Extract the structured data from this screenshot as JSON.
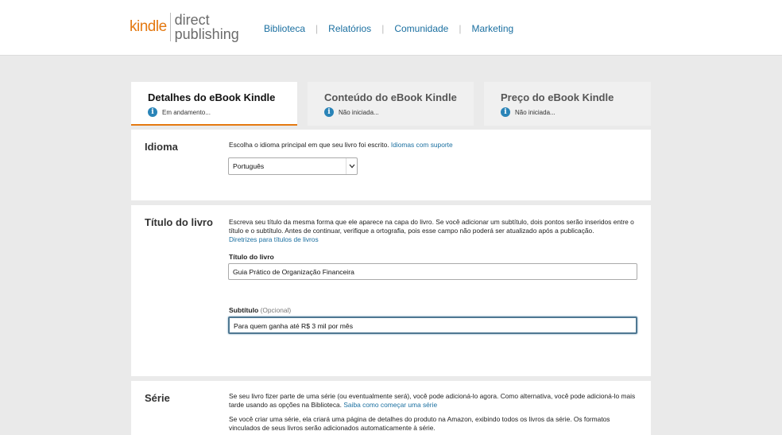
{
  "header": {
    "logo_kindle": "kindle",
    "logo_direct": "direct",
    "logo_publishing": "publishing",
    "nav": [
      "Biblioteca",
      "Relatórios",
      "Comunidade",
      "Marketing"
    ],
    "nav_separator": "|"
  },
  "tabs": [
    {
      "title": "Detalhes do eBook Kindle",
      "status": "Em andamento...",
      "active": true
    },
    {
      "title": "Conteúdo do eBook Kindle",
      "status": "Não iniciada...",
      "active": false
    },
    {
      "title": "Preço do eBook Kindle",
      "status": "Não iniciada...",
      "active": false
    }
  ],
  "info_glyph": "i",
  "idioma": {
    "title": "Idioma",
    "description": "Escolha o idioma principal em que seu livro foi escrito.",
    "link": "Idiomas com suporte",
    "selected": "Português"
  },
  "titulo": {
    "title": "Título do livro",
    "description": "Escreva seu título da mesma forma que ele aparece na capa do livro. Se você adicionar um subtítulo, dois pontos serão inseridos entre o título e o subtítulo. Antes de continuar, verifique a ortografia, pois esse campo não poderá ser atualizado após a publicação.",
    "link": "Diretrizes para títulos de livros",
    "title_label": "Título do livro",
    "title_value": "Guia Prático de Organização Financeira",
    "subtitle_label": "Subtítulo",
    "subtitle_optional": "(Opcional)",
    "subtitle_value": "Para quem ganha até R$ 3 mil por mês"
  },
  "serie": {
    "title": "Série",
    "description1": "Se seu livro fizer parte de uma série (ou eventualmente será), você pode adicioná-lo agora. Como alternativa, você pode adicioná-lo mais tarde usando as opções na Biblioteca.",
    "link": "Saiba como começar uma série",
    "description2": "Se você criar uma série, ela criará uma página de detalhes do produto na Amazon, exibindo todos os livros da série. Os formatos vinculados de seus livros serão adicionados automaticamente à série."
  }
}
